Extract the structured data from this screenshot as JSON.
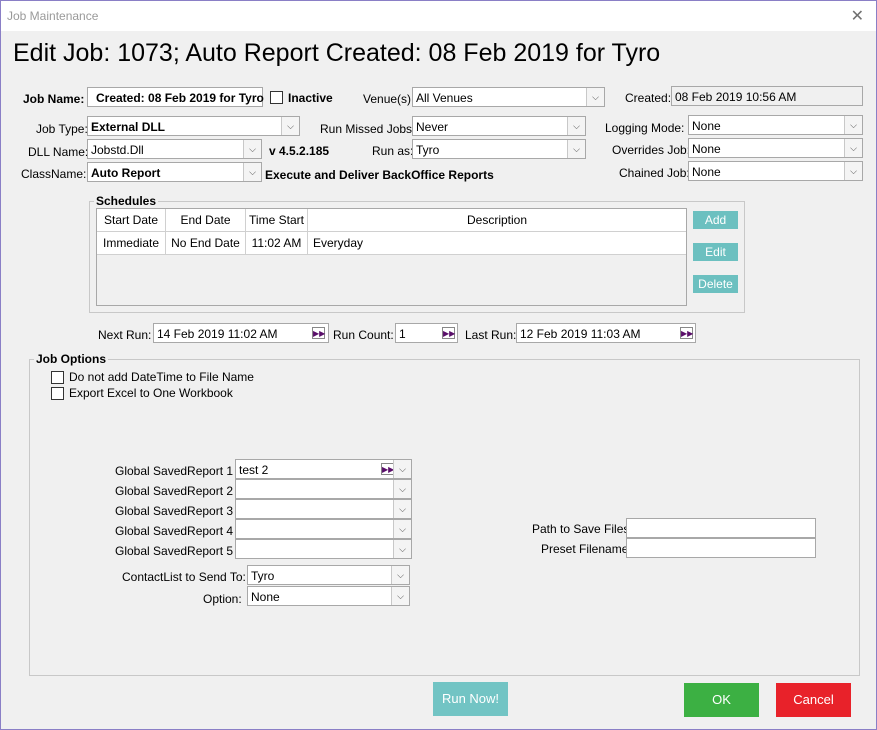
{
  "window": {
    "title": "Job Maintenance",
    "close_glyph": "✕"
  },
  "heading": "Edit Job: 1073; Auto Report Created: 08 Feb 2019 for Tyro",
  "job": {
    "name_label": "Job Name:",
    "name_value": "Created: 08 Feb 2019 for Tyro",
    "inactive_label": "Inactive",
    "venues_label": "Venue(s):",
    "venues_value": "All Venues",
    "created_label": "Created:",
    "created_value": "08 Feb 2019 10:56 AM",
    "job_type_label": "Job Type:",
    "job_type_value": "External DLL",
    "run_missed_label": "Run Missed Jobs:",
    "run_missed_value": "Never",
    "logging_label": "Logging Mode:",
    "logging_value": "None",
    "dll_label": "DLL Name:",
    "dll_value": "Jobstd.Dll",
    "version": "v 4.5.2.185",
    "run_as_label": "Run as:",
    "run_as_value": "Tyro",
    "overrides_label": "Overrides Job:",
    "overrides_value": "None",
    "classname_label": "ClassName:",
    "classname_value": "Auto Report",
    "class_desc": "Execute and Deliver BackOffice Reports",
    "chained_label": "Chained Job:",
    "chained_value": "None"
  },
  "schedules": {
    "title": "Schedules",
    "columns": [
      "Start Date",
      "End Date",
      "Time Start",
      "Description"
    ],
    "rows": [
      [
        "Immediate",
        "No End Date",
        "11:02 AM",
        "Everyday"
      ]
    ],
    "add": "Add",
    "edit": "Edit",
    "delete": "Delete"
  },
  "run_info": {
    "next_run_label": "Next Run:",
    "next_run_value": "14 Feb 2019 11:02 AM",
    "run_count_label": "Run Count:",
    "run_count_value": "1",
    "last_run_label": "Last Run:",
    "last_run_value": "12 Feb 2019 11:03 AM"
  },
  "options": {
    "title": "Job Options",
    "no_datetime": "Do not add DateTime to File Name",
    "excel_one": "Export Excel to One Workbook",
    "reports": [
      {
        "label": "Global SavedReport 1",
        "value": "test 2"
      },
      {
        "label": "Global SavedReport 2",
        "value": ""
      },
      {
        "label": "Global SavedReport 3",
        "value": ""
      },
      {
        "label": "Global SavedReport 4",
        "value": ""
      },
      {
        "label": "Global SavedReport 5",
        "value": ""
      }
    ],
    "contact_label": "ContactList to Send To:",
    "contact_value": "Tyro",
    "option_label": "Option:",
    "option_value": "None",
    "path_label": "Path to Save Files",
    "path_value": "",
    "preset_label": "Preset Filename",
    "preset_value": ""
  },
  "footer": {
    "run_now": "Run Now!",
    "ok": "OK",
    "cancel": "Cancel"
  },
  "icons": {
    "dropdown": "chevron-down-icon",
    "fast_forward": "fast-forward-icon"
  },
  "colors": {
    "teal_button": "#6cc0c0",
    "ok_green": "#3cb043",
    "cancel_red": "#e8222a",
    "ff_icon": "#5a0f6a"
  }
}
